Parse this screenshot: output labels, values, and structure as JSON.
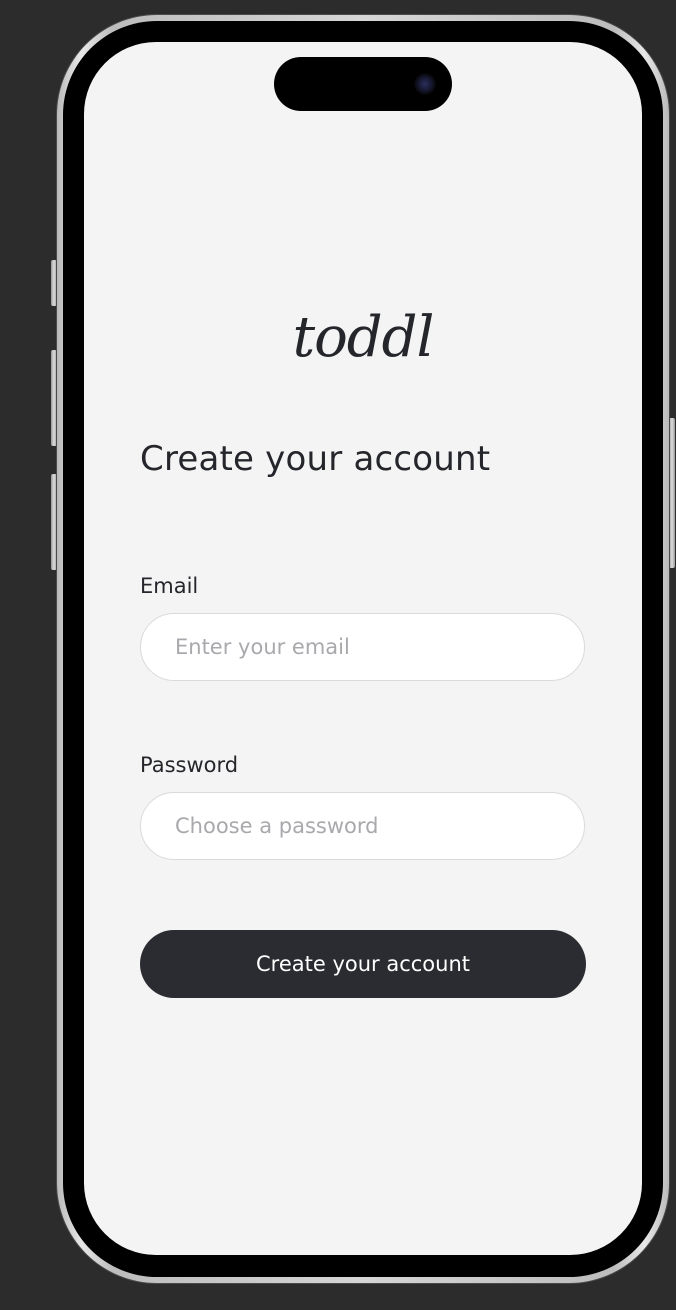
{
  "app": {
    "logo_text": "toddl"
  },
  "signup": {
    "heading": "Create your account",
    "email": {
      "label": "Email",
      "placeholder": "Enter your email",
      "value": ""
    },
    "password": {
      "label": "Password",
      "placeholder": "Choose a password",
      "value": ""
    },
    "submit_label": "Create your account"
  },
  "colors": {
    "background": "#f4f4f4",
    "text": "#25262b",
    "button_bg": "#2b2c31",
    "button_text": "#ffffff",
    "input_border": "#dadada",
    "placeholder": "#a9a9ad"
  }
}
